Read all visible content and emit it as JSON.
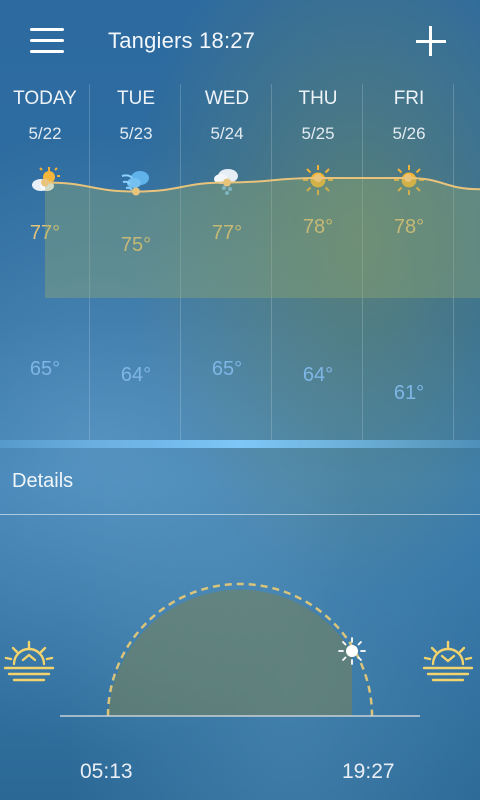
{
  "header": {
    "city_time": "Tangiers 18:27",
    "menu_icon": "hamburger-menu-icon",
    "add_icon": "plus-icon"
  },
  "forecast": [
    {
      "day": "TODAY",
      "date": "5/22",
      "icon": "partly-cloudy-icon",
      "high": "77°",
      "low": "65°",
      "high_value": 77,
      "low_value": 65
    },
    {
      "day": "TUE",
      "date": "5/23",
      "icon": "windy-icon",
      "high": "75°",
      "low": "64°",
      "high_value": 75,
      "low_value": 64
    },
    {
      "day": "WED",
      "date": "5/24",
      "icon": "cloudy-rain-icon",
      "high": "77°",
      "low": "65°",
      "high_value": 77,
      "low_value": 65
    },
    {
      "day": "THU",
      "date": "5/25",
      "icon": "sunny-icon",
      "high": "78°",
      "low": "64°",
      "high_value": 78,
      "low_value": 64
    },
    {
      "day": "FRI",
      "date": "5/26",
      "icon": "sunny-icon",
      "high": "78°",
      "low": "61°",
      "high_value": 78,
      "low_value": 61
    }
  ],
  "details": {
    "title": "Details",
    "sunrise": "05:13",
    "sunset": "19:27",
    "sunrise_icon": "sunrise-icon",
    "sunset_icon": "sunset-icon",
    "sun_icon": "sun-icon"
  },
  "colors": {
    "high_line": "#e8c37c",
    "low_line": "#6fb0ea",
    "sun_arc": "#d9c47a"
  }
}
